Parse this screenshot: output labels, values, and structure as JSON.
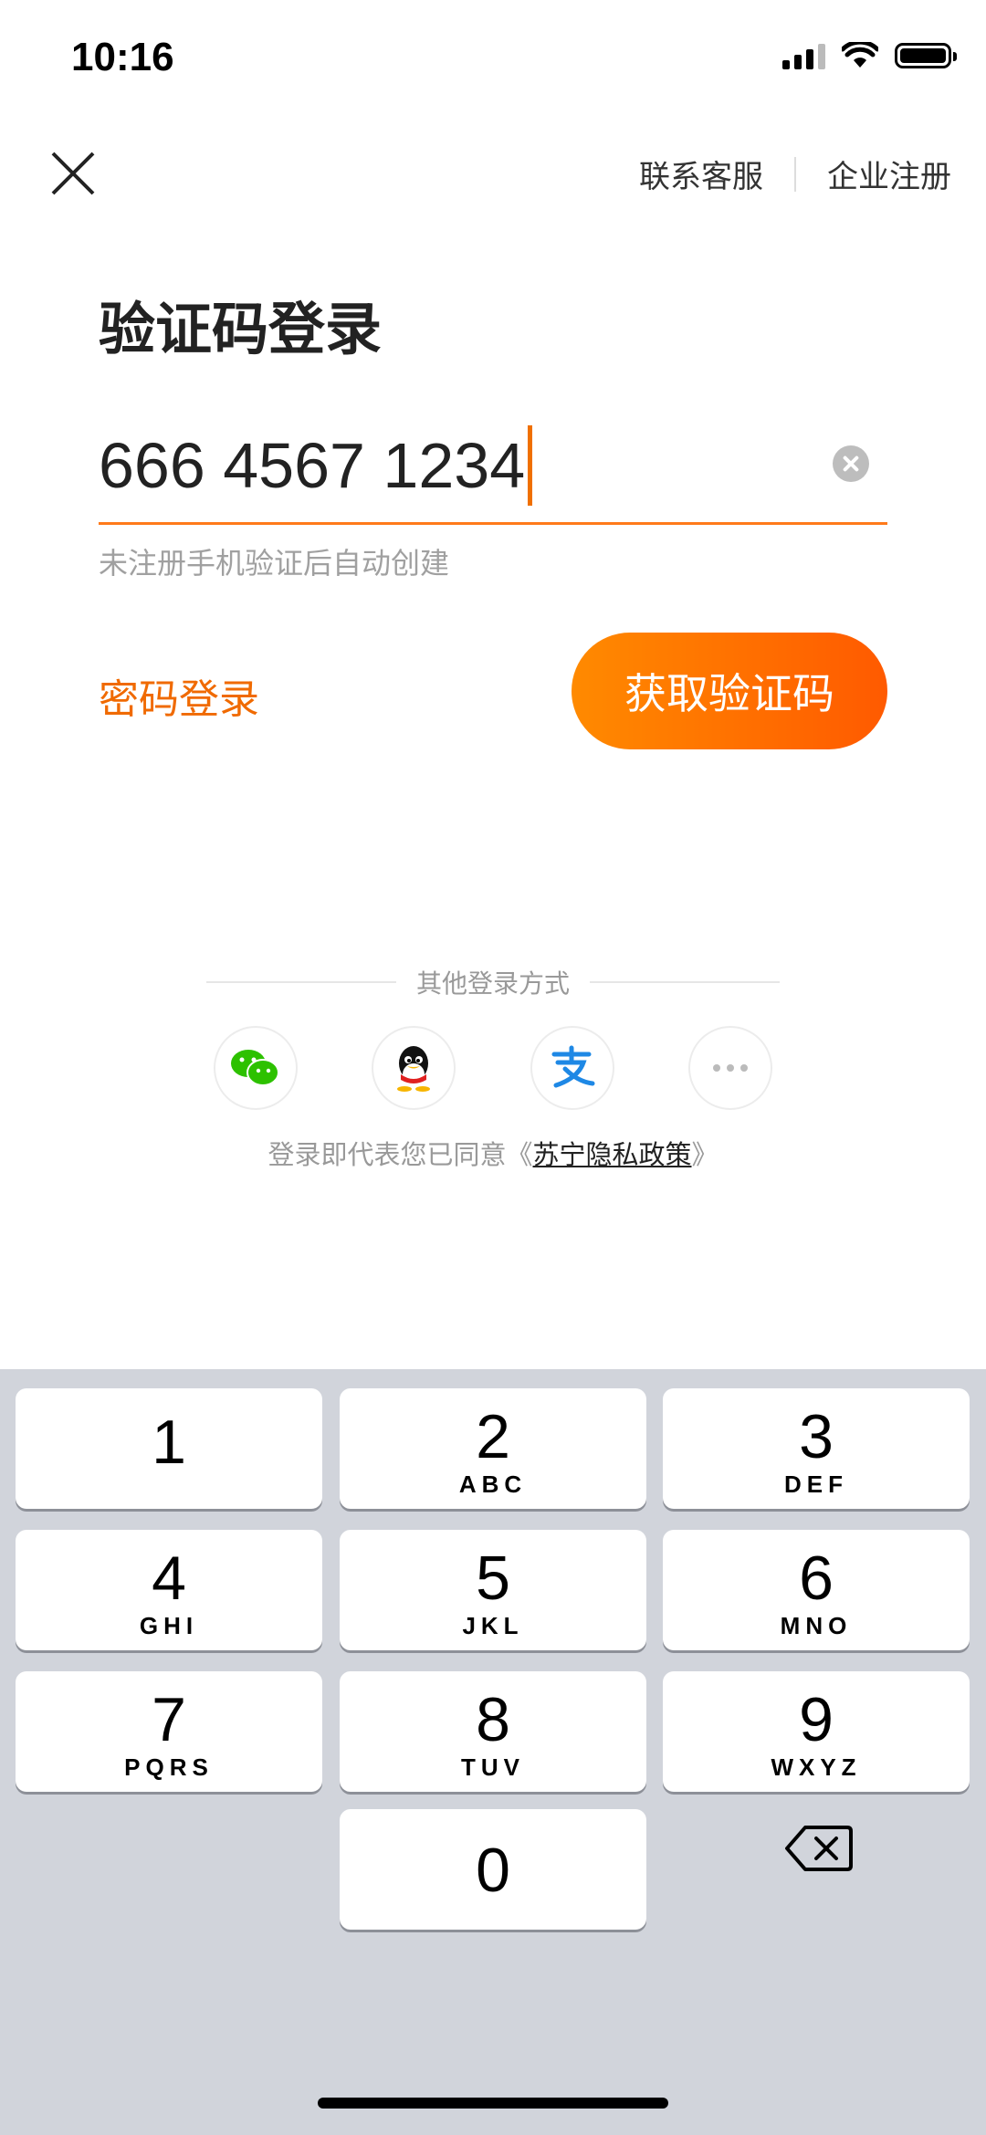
{
  "status_bar": {
    "time": "10:16",
    "signal_icon": "cellular-signal-icon",
    "wifi_icon": "wifi-icon",
    "battery_icon": "battery-icon"
  },
  "header": {
    "close_icon": "close-icon",
    "links": {
      "customer_service": "联系客服",
      "enterprise_register": "企业注册"
    }
  },
  "title": "验证码登录",
  "phone_input": {
    "value": "666 4567 1234",
    "clear_icon": "clear-icon",
    "accent_color": "#ff7a1a",
    "hint": "未注册手机验证后自动创建"
  },
  "actions": {
    "password_login": "密码登录",
    "get_code": "获取验证码"
  },
  "other_login": {
    "label": "其他登录方式",
    "methods": [
      "wechat-icon",
      "qq-icon",
      "alipay-icon",
      "more-icon"
    ]
  },
  "agreement": {
    "prefix": "登录即代表您已同意",
    "open": "《",
    "link": "苏宁隐私政策",
    "close": "》"
  },
  "keypad": {
    "keys": [
      {
        "num": "1",
        "letters": ""
      },
      {
        "num": "2",
        "letters": "ABC"
      },
      {
        "num": "3",
        "letters": "DEF"
      },
      {
        "num": "4",
        "letters": "GHI"
      },
      {
        "num": "5",
        "letters": "JKL"
      },
      {
        "num": "6",
        "letters": "MNO"
      },
      {
        "num": "7",
        "letters": "PQRS"
      },
      {
        "num": "8",
        "letters": "TUV"
      },
      {
        "num": "9",
        "letters": "WXYZ"
      },
      {
        "num": "0",
        "letters": ""
      }
    ],
    "delete_icon": "backspace-icon"
  },
  "colors": {
    "brand_orange": "#ff6a00",
    "keyboard_bg": "#d1d4db"
  }
}
